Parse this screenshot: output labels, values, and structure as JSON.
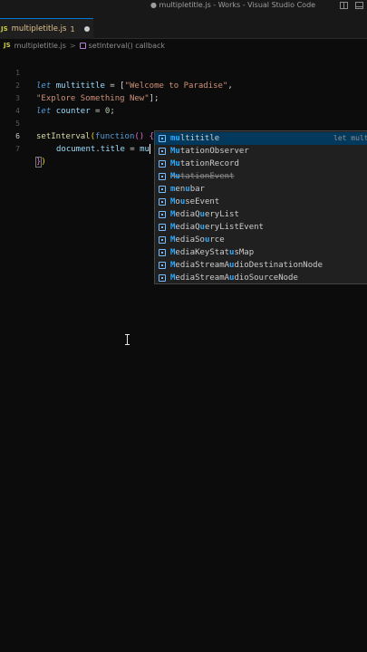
{
  "window": {
    "title": "● multipletitle.js - Works - Visual Studio Code"
  },
  "tab": {
    "file_type": "JS",
    "label": "multipletitle.js",
    "problem_count": "1"
  },
  "breadcrumb": {
    "file_type": "JS",
    "file": "multipletitle.js",
    "separator": ">",
    "symbol": "setInterval() callback"
  },
  "editor": {
    "line_numbers": [
      "1",
      "2",
      "3",
      "4",
      "5",
      "6",
      "7"
    ],
    "line1": {
      "kw": "let",
      "var": "multititle",
      "eq": " = [",
      "str": "\"Welcome to Paradise\"",
      "end": ","
    },
    "line2": {
      "str": "\"Explore Something New\"",
      "end": "];"
    },
    "line3": {
      "kw": "let",
      "var": "counter",
      "eq": " = ",
      "num": "0",
      "end": ";"
    },
    "line5": {
      "fn": "setInterval",
      "open": "(",
      "kw": "function",
      "paren": "()",
      "brace": " {"
    },
    "line6": {
      "obj": "document",
      "dot": ".",
      "prop": "title",
      "eq": " = ",
      "typed": "mu"
    },
    "line7": {
      "brace": "}",
      "paren": ")"
    }
  },
  "suggestions": {
    "items": [
      {
        "match": "mu",
        "rest": "ltititle",
        "detail": "let multititle"
      },
      {
        "match": "Mu",
        "rest": "tationObserver"
      },
      {
        "match": "Mu",
        "rest": "tationRecord"
      },
      {
        "match": "Mu",
        "rest": "tationEvent"
      },
      {
        "match": "m",
        "rest": "en",
        "match2": "u",
        "rest2": "bar"
      },
      {
        "match": "M",
        "rest": "o",
        "match2": "u",
        "rest2": "seEvent"
      },
      {
        "match": "M",
        "rest": "ediaQ",
        "match2": "u",
        "rest2": "eryList"
      },
      {
        "match": "M",
        "rest": "ediaQ",
        "match2": "u",
        "rest2": "eryListEvent"
      },
      {
        "match": "M",
        "rest": "ediaSo",
        "match2": "u",
        "rest2": "rce"
      },
      {
        "match": "M",
        "rest": "ediaKeyStat",
        "match2": "u",
        "rest2": "sMap"
      },
      {
        "match": "M",
        "rest": "ediaStreamA",
        "match2": "u",
        "rest2": "dioDestinationNode"
      },
      {
        "match": "M",
        "rest": "ediaStreamA",
        "match2": "u",
        "rest2": "dioSourceNode"
      }
    ]
  }
}
